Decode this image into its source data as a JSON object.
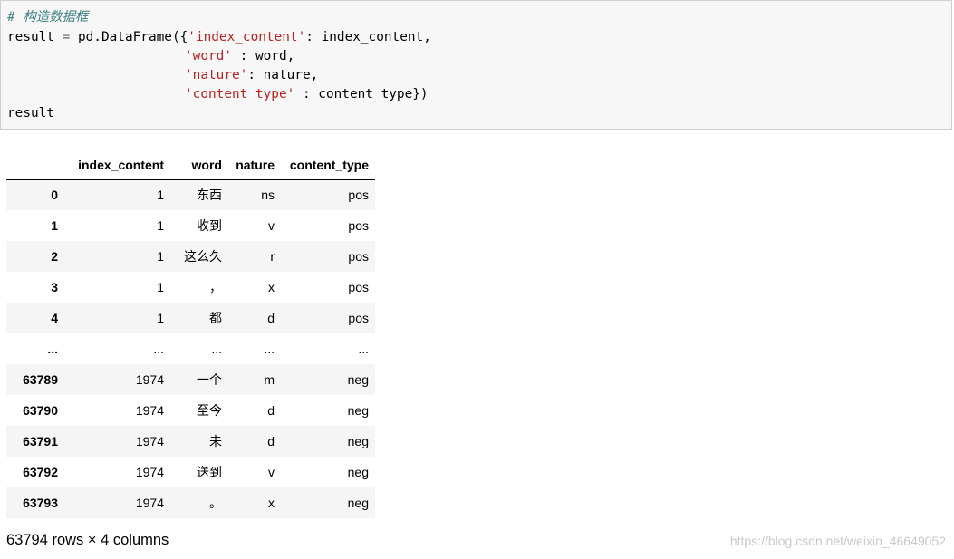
{
  "code": {
    "comment": "# 构造数据框",
    "line1": {
      "var": "result",
      "op": " = ",
      "call": "pd.DataFrame({",
      "key": "'index_content'",
      "val": ": index_content,"
    },
    "line2": {
      "key": "'word'",
      "val": " : word,"
    },
    "line3": {
      "key": "'nature'",
      "val": ": nature,"
    },
    "line4": {
      "key": "'content_type'",
      "val": " : content_type})"
    },
    "line5": "result"
  },
  "table": {
    "headers": [
      "",
      "index_content",
      "word",
      "nature",
      "content_type"
    ],
    "rows": [
      {
        "index": "0",
        "index_content": "1",
        "word": "东西",
        "nature": "ns",
        "content_type": "pos"
      },
      {
        "index": "1",
        "index_content": "1",
        "word": "收到",
        "nature": "v",
        "content_type": "pos"
      },
      {
        "index": "2",
        "index_content": "1",
        "word": "这么久",
        "nature": "r",
        "content_type": "pos"
      },
      {
        "index": "3",
        "index_content": "1",
        "word": "，",
        "nature": "x",
        "content_type": "pos"
      },
      {
        "index": "4",
        "index_content": "1",
        "word": "都",
        "nature": "d",
        "content_type": "pos"
      },
      {
        "index": "...",
        "index_content": "...",
        "word": "...",
        "nature": "...",
        "content_type": "..."
      },
      {
        "index": "63789",
        "index_content": "1974",
        "word": "一个",
        "nature": "m",
        "content_type": "neg"
      },
      {
        "index": "63790",
        "index_content": "1974",
        "word": "至今",
        "nature": "d",
        "content_type": "neg"
      },
      {
        "index": "63791",
        "index_content": "1974",
        "word": "未",
        "nature": "d",
        "content_type": "neg"
      },
      {
        "index": "63792",
        "index_content": "1974",
        "word": "送到",
        "nature": "v",
        "content_type": "neg"
      },
      {
        "index": "63793",
        "index_content": "1974",
        "word": "。",
        "nature": "x",
        "content_type": "neg"
      }
    ]
  },
  "summary": "63794 rows × 4 columns",
  "watermark": "https://blog.csdn.net/weixin_46649052"
}
